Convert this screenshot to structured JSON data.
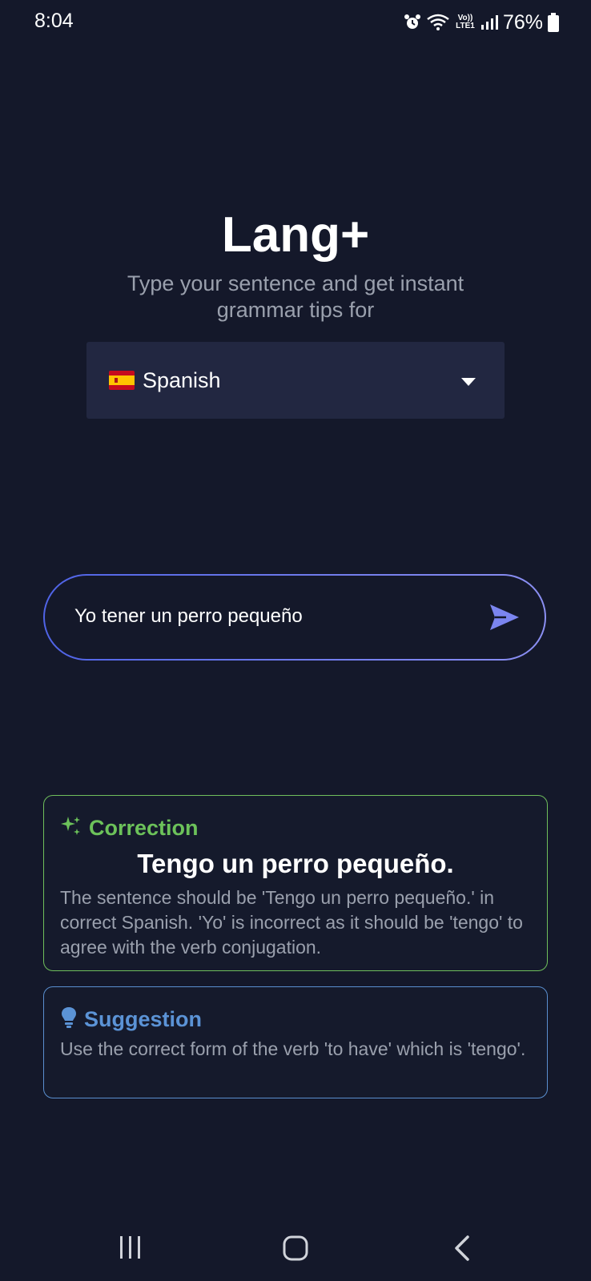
{
  "status_bar": {
    "time": "8:04",
    "battery_percent": "76%",
    "network_label": "Vo)) LTE1",
    "icons": [
      "alarm-icon",
      "wifi-icon",
      "lte-icon",
      "signal-icon",
      "battery-icon"
    ]
  },
  "header": {
    "title": "Lang+",
    "subtitle": "Type your sentence and get instant grammar tips for"
  },
  "language_select": {
    "flag": "spain-flag-icon",
    "selected": "Spanish",
    "caret": "caret-down-icon"
  },
  "input": {
    "value": "Yo tener un perro pequeño",
    "send_icon": "send-icon"
  },
  "correction_card": {
    "label": "Correction",
    "icon": "sparkles-icon",
    "corrected_sentence": "Tengo un perro pequeño.",
    "explanation": "The sentence should be 'Tengo un perro pequeño.' in correct Spanish. 'Yo' is incorrect as it should be 'tengo' to agree with the verb conjugation."
  },
  "suggestion_card": {
    "label": "Suggestion",
    "icon": "lightbulb-icon",
    "text": "Use the correct form of the verb 'to have' which is 'tengo'."
  },
  "nav_bar": {
    "buttons": [
      "recent-apps-icon",
      "home-icon",
      "back-icon"
    ]
  },
  "colors": {
    "background": "#14182a",
    "select_bg": "#222741",
    "correction_accent": "#6cc25a",
    "suggestion_accent": "#5b93d6",
    "input_gradient_start": "#4f63e6",
    "input_gradient_end": "#8b8ff2"
  }
}
